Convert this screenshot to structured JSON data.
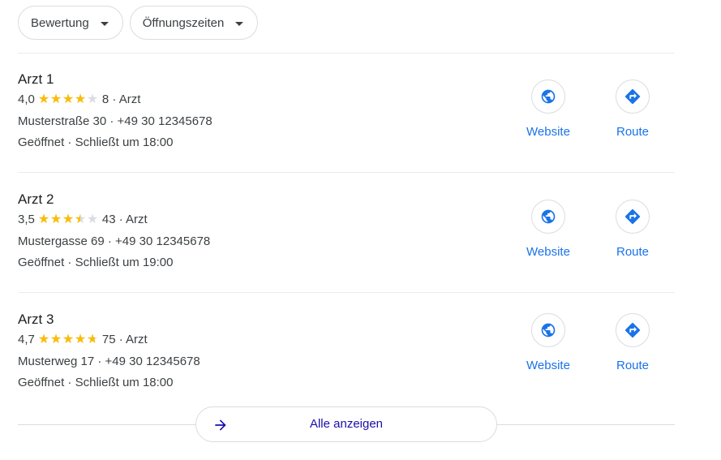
{
  "filters": [
    {
      "label": "Bewertung"
    },
    {
      "label": "Öffnungszeiten"
    }
  ],
  "results": [
    {
      "name": "Arzt 1",
      "rating_text": "4,0",
      "rating": 4.0,
      "review_count_text": "8 · Arzt",
      "address_phone": "Musterstraße 30 · +49 30 12345678",
      "hours": "Geöffnet · Schließt um 18:00",
      "website_label": "Website",
      "route_label": "Route"
    },
    {
      "name": "Arzt 2",
      "rating_text": "3,5",
      "rating": 3.5,
      "review_count_text": "43 · Arzt",
      "address_phone": "Mustergasse 69 · +49 30 12345678",
      "hours": "Geöffnet · Schließt um 19:00",
      "website_label": "Website",
      "route_label": "Route"
    },
    {
      "name": "Arzt 3",
      "rating_text": "4,7",
      "rating": 4.7,
      "review_count_text": "75 · Arzt",
      "address_phone": "Musterweg 17 · +49 30 12345678",
      "hours": "Geöffnet · Schließt um 18:00",
      "website_label": "Website",
      "route_label": "Route"
    }
  ],
  "show_all": {
    "label": "Alle anzeigen"
  },
  "colors": {
    "star": "#fbbc04",
    "star_empty": "#dadce0",
    "action_blue": "#1a73e8",
    "link_dark_blue": "#1a0dab"
  },
  "icons": {
    "website": "globe-icon",
    "route": "directions-icon",
    "show_all": "arrow-right-icon",
    "filter_caret": "caret-down-icon"
  }
}
